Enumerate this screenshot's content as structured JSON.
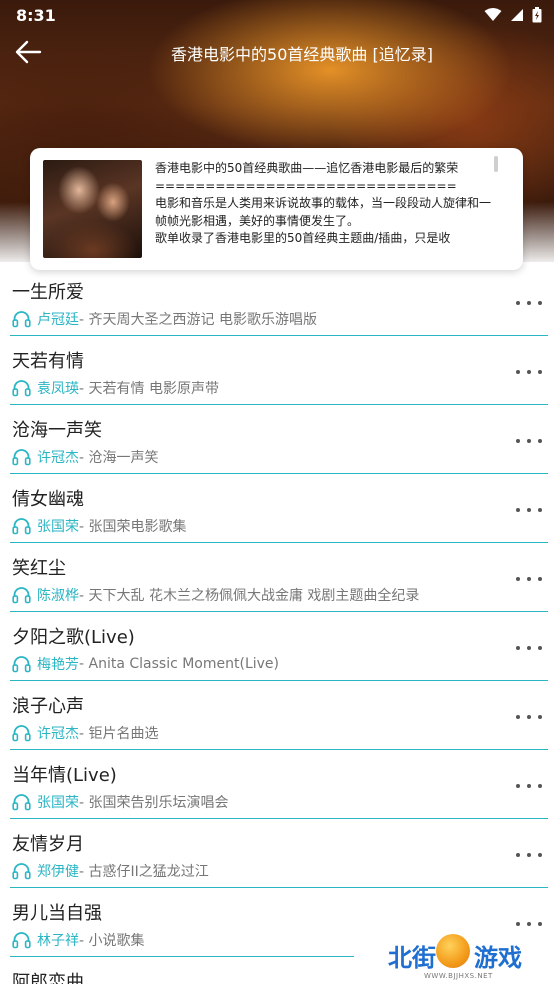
{
  "status_bar": {
    "time": "8:31"
  },
  "header": {
    "title": "香港电影中的50首经典歌曲 [追忆录]"
  },
  "description": {
    "text": "香港电影中的50首经典歌曲——追忆香港电影最后的繁荣\n==============================\n电影和音乐是人类用来诉说故事的载体，当一段段动人旋律和一帧帧光影相遇，美好的事情便发生了。\n歌单收录了香港电影里的50首经典主题曲/插曲，只是收"
  },
  "songs": [
    {
      "title": "一生所爱",
      "artist": "卢冠廷",
      "album": " - 齐天周大圣之西游记 电影歌乐游唱版"
    },
    {
      "title": "天若有情",
      "artist": "袁凤瑛",
      "album": " - 天若有情 电影原声带"
    },
    {
      "title": "沧海一声笑",
      "artist": "许冠杰",
      "album": " - 沧海一声笑"
    },
    {
      "title": "倩女幽魂",
      "artist": "张国荣",
      "album": " - 张国荣电影歌集"
    },
    {
      "title": "笑红尘",
      "artist": "陈淑桦",
      "album": " - 天下大乱 花木兰之杨佩佩大战金庸 戏剧主题曲全纪录"
    },
    {
      "title": "夕阳之歌(Live)",
      "artist": "梅艳芳",
      "album": " - Anita Classic Moment(Live)"
    },
    {
      "title": "浪子心声",
      "artist": "许冠杰",
      "album": " - 钜片名曲选"
    },
    {
      "title": "当年情(Live)",
      "artist": "张国荣",
      "album": " - 张国荣告别乐坛演唱会"
    },
    {
      "title": "友情岁月",
      "artist": "郑伊健",
      "album": " - 古惑仔II之猛龙过江"
    },
    {
      "title": "男儿当自强",
      "artist": "林子祥",
      "album": " - 小说歌集"
    },
    {
      "title": "阿郎恋曲",
      "artist": "",
      "album": ""
    }
  ],
  "watermark": {
    "left": "北街",
    "right": "游戏",
    "url": "WWW.BJJHXS.NET"
  },
  "colors": {
    "accent": "#2bb6c4",
    "divider": "#2bb6c4",
    "watermark": "#1f6fd0"
  },
  "icons": {
    "back": "arrow-left-icon",
    "more": "more-dots-icon",
    "song": "headphones-icon"
  }
}
